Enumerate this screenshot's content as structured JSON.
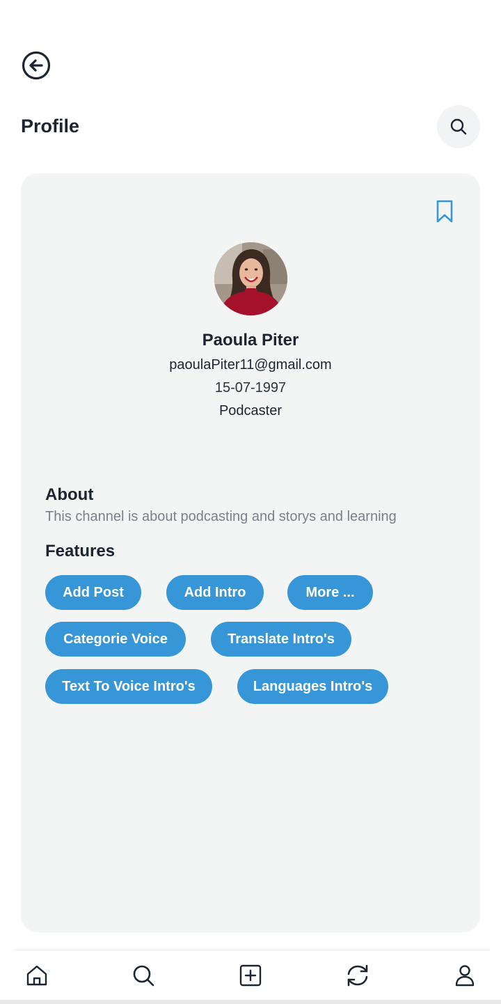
{
  "header": {
    "back_icon": "arrow-left-circle-icon",
    "title": "Profile",
    "search_icon": "search-icon"
  },
  "profile": {
    "bookmark_icon": "bookmark-icon",
    "avatar": "profile-photo",
    "name": "Paoula Piter",
    "email": "paoulaPiter11@gmail.com",
    "dob": "15-07-1997",
    "role": "Podcaster"
  },
  "about": {
    "title": "About",
    "text": "This channel is about podcasting and storys and learning"
  },
  "features": {
    "title": "Features",
    "items": [
      "Add Post",
      "Add Intro",
      "More ...",
      "Categorie Voice",
      "Translate Intro's",
      "Text To Voice Intro's",
      "Languages Intro's"
    ]
  },
  "nav": {
    "items": [
      "home-icon",
      "search-icon",
      "add-square-icon",
      "refresh-icon",
      "user-icon"
    ]
  },
  "colors": {
    "accent": "#3796d8",
    "card_bg": "#f3f4f4",
    "text_dark": "#1c2430",
    "text_muted": "#7b8088"
  }
}
